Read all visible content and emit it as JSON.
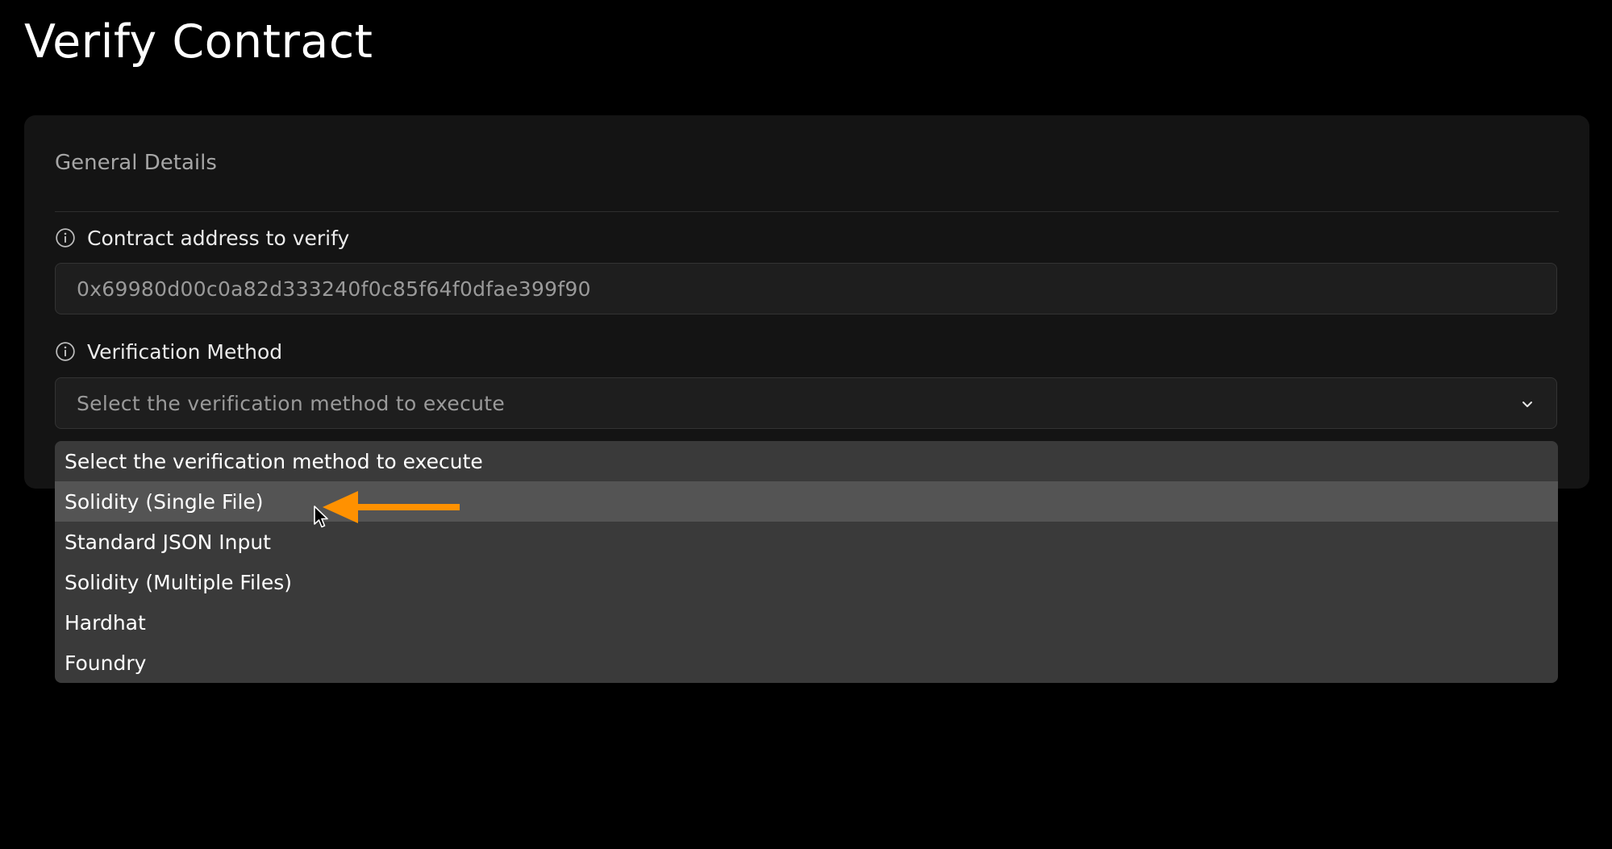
{
  "page": {
    "title": "Verify Contract"
  },
  "card": {
    "section_title": "General Details",
    "address_field": {
      "label": "Contract address to verify",
      "value": "0x69980d00c0a82d333240f0c85f64f0dfae399f90",
      "icon": "info-icon"
    },
    "method_field": {
      "label": "Verification Method",
      "selected": "Select the verification method to execute",
      "icon": "info-icon"
    }
  },
  "dropdown": {
    "options": [
      {
        "label": "Select the verification method to execute"
      },
      {
        "label": "Solidity (Single File)",
        "hovered": true
      },
      {
        "label": "Standard JSON Input"
      },
      {
        "label": "Solidity (Multiple Files)"
      },
      {
        "label": "Hardhat"
      },
      {
        "label": "Foundry"
      }
    ]
  },
  "colors": {
    "background": "#000000",
    "card": "#141414",
    "dropdown": "#3a3a3a",
    "hover": "#545454",
    "annotation_arrow": "#ff9100"
  }
}
